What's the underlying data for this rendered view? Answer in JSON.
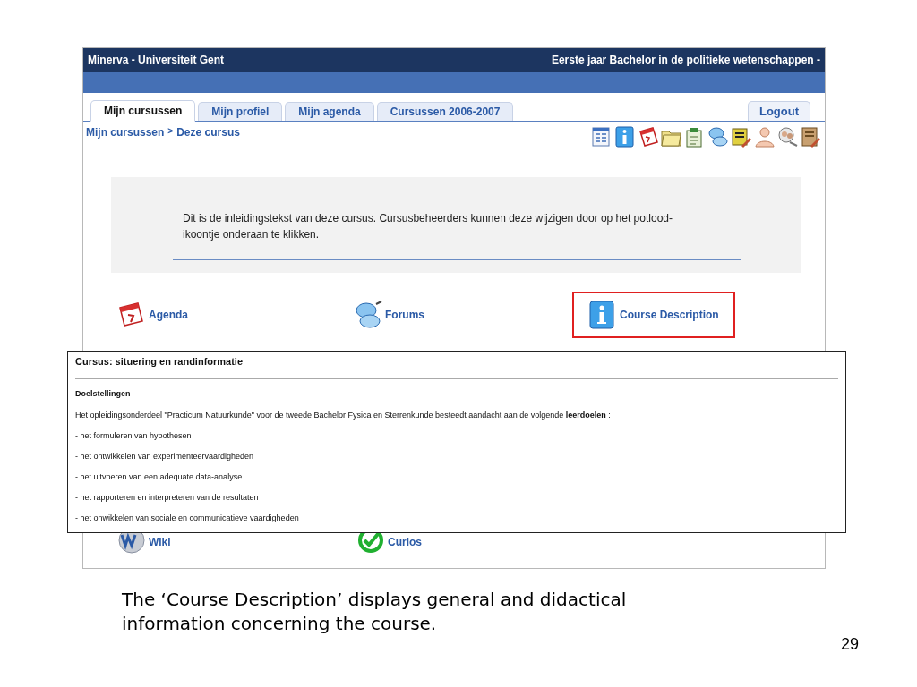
{
  "window": {
    "title": "Minerva - Universiteit Gent",
    "context": "Eerste jaar Bachelor in de politieke wetenschappen -"
  },
  "tabs": [
    {
      "label": "Mijn cursussen",
      "selected": true
    },
    {
      "label": "Mijn profiel",
      "selected": false
    },
    {
      "label": "Mijn agenda",
      "selected": false
    },
    {
      "label": "Cursussen 2006-2007",
      "selected": false
    }
  ],
  "logout": "Logout",
  "breadcrumb": [
    "Mijn cursussen",
    ">",
    "Deze cursus"
  ],
  "intro": "Dit is de inleidingstekst van deze cursus. Cursusbeheerders kunnen deze wijzigen door op het potlood-ikoontje onderaan te klikken.",
  "tools": [
    {
      "label": "Agenda",
      "kind": "agenda",
      "highlighted": false
    },
    {
      "label": "Forums",
      "kind": "forums",
      "highlighted": false
    },
    {
      "label": "Course Description",
      "kind": "info",
      "highlighted": true
    }
  ],
  "tools_bottom": [
    {
      "label": "Wiki",
      "kind": "wiki",
      "highlighted": false
    },
    {
      "label": "Curios",
      "kind": "check",
      "highlighted": false
    }
  ],
  "popup": {
    "title": "Cursus: situering en randinformatie",
    "heading": "Doelstellingen",
    "paragraph": "Het opleidingsonderdeel \"Practicum Natuurkunde\" voor de tweede Bachelor Fysica en Sterrenkunde besteedt aandacht aan de volgende **leerdoelen** :",
    "items": [
      "- het formuleren van hypothesen",
      "- het ontwikkelen van experimenteervaardigheden",
      "- het uitvoeren van een adequate data-analyse",
      "- het rapporteren en interpreteren van de resultaten",
      "- het onwikkelen van sociale en communicatieve vaardigheden"
    ]
  },
  "caption": "The ‘Course Description’ displays general and didactical information concerning the course.",
  "page_number": "29"
}
